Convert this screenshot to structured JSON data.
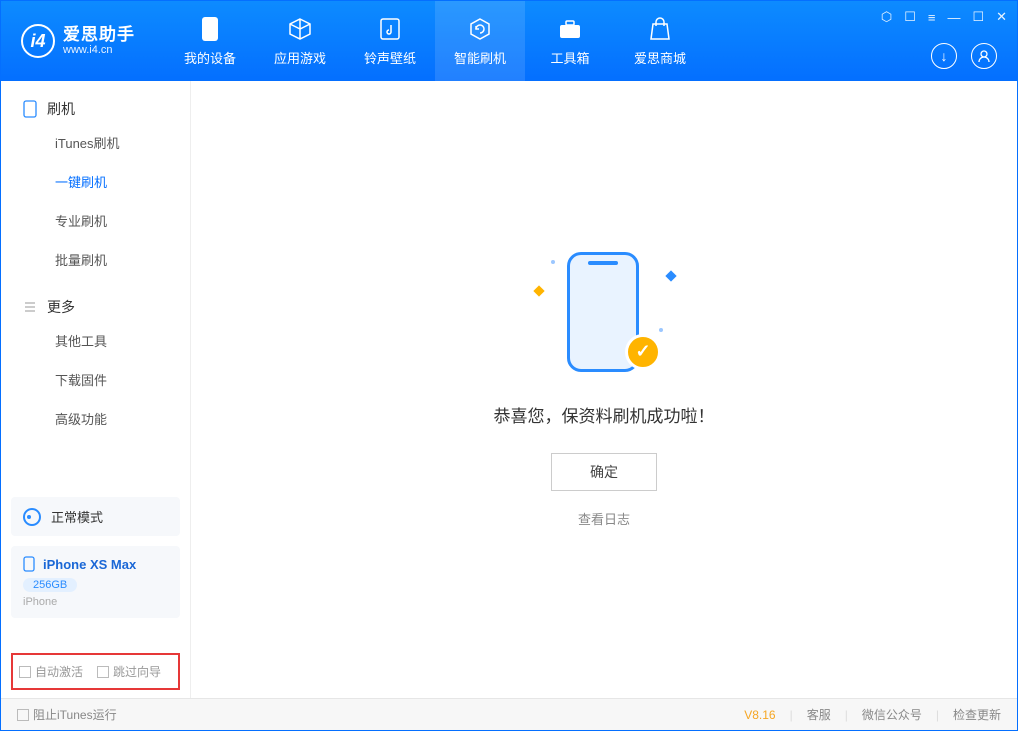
{
  "app": {
    "title": "爱思助手",
    "subtitle": "www.i4.cn"
  },
  "nav": {
    "items": [
      {
        "label": "我的设备"
      },
      {
        "label": "应用游戏"
      },
      {
        "label": "铃声壁纸"
      },
      {
        "label": "智能刷机"
      },
      {
        "label": "工具箱"
      },
      {
        "label": "爱思商城"
      }
    ]
  },
  "sidebar": {
    "group_flash": "刷机",
    "flash_items": [
      "iTunes刷机",
      "一键刷机",
      "专业刷机",
      "批量刷机"
    ],
    "group_more": "更多",
    "more_items": [
      "其他工具",
      "下载固件",
      "高级功能"
    ],
    "mode_label": "正常模式",
    "device": {
      "name": "iPhone XS Max",
      "capacity": "256GB",
      "type": "iPhone"
    },
    "check_auto_activate": "自动激活",
    "check_skip_guide": "跳过向导"
  },
  "main": {
    "success_text": "恭喜您，保资料刷机成功啦！",
    "ok_button": "确定",
    "view_log": "查看日志"
  },
  "footer": {
    "block_itunes": "阻止iTunes运行",
    "version": "V8.16",
    "support": "客服",
    "wechat": "微信公众号",
    "update": "检查更新"
  }
}
